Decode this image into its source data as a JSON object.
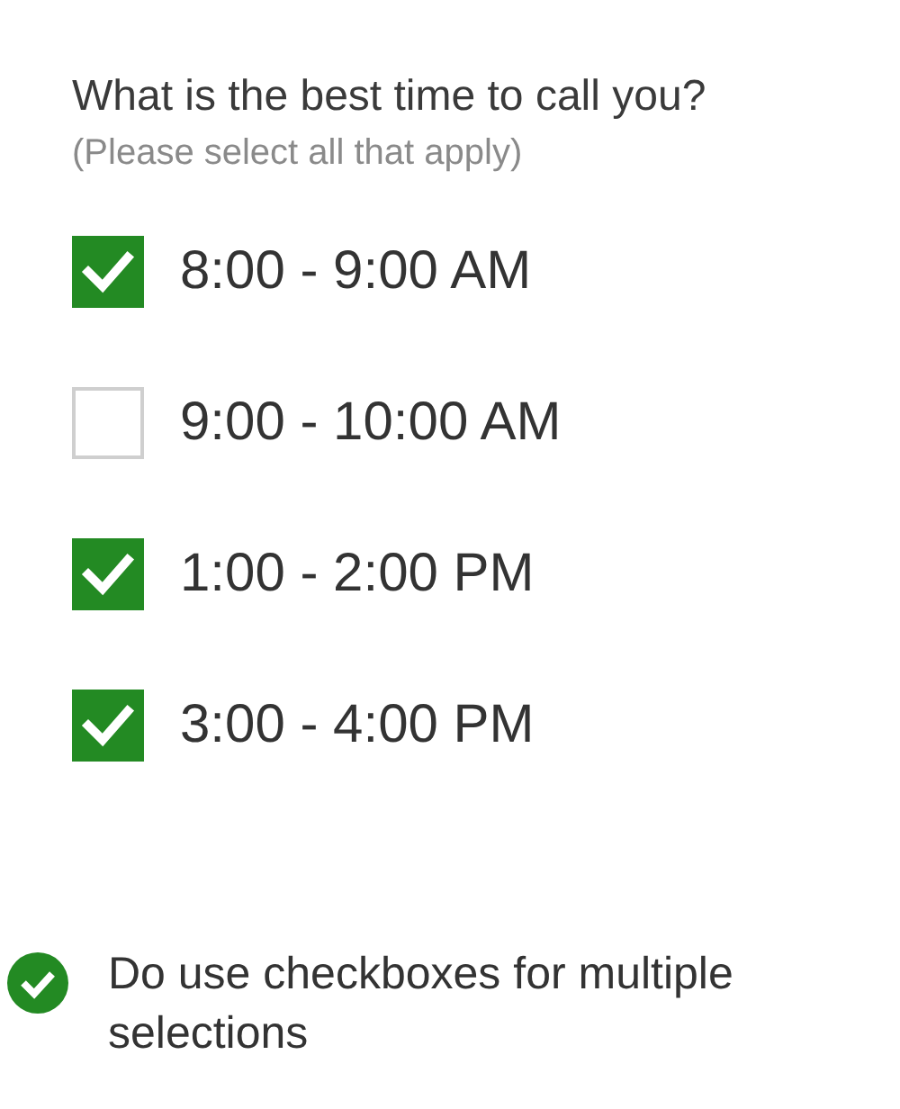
{
  "question": "What is the best time to call you?",
  "hint": "(Please select all that apply)",
  "options": [
    {
      "label": "8:00 - 9:00 AM",
      "checked": true
    },
    {
      "label": "9:00 - 10:00 AM",
      "checked": false
    },
    {
      "label": "1:00 - 2:00 PM",
      "checked": true
    },
    {
      "label": "3:00 - 4:00 PM",
      "checked": true
    }
  ],
  "note": {
    "kind": "do",
    "text": "Do use checkboxes for multiple selections"
  }
}
